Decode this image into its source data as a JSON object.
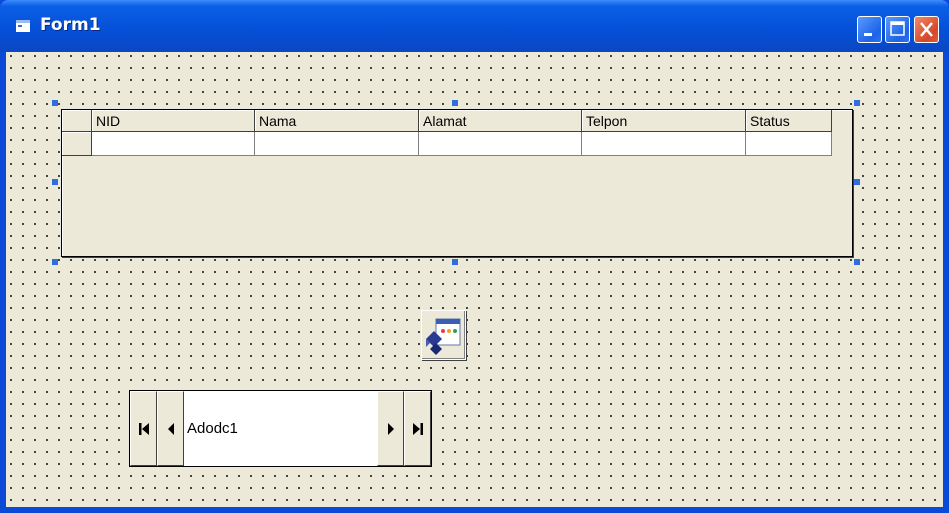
{
  "window": {
    "title": "Form1",
    "colors": {
      "titlebar": "#0551d8",
      "form_background": "#ece9d8",
      "close_button": "#d6462a"
    }
  },
  "title_buttons": [
    "minimize-icon",
    "maximize-icon",
    "close-icon"
  ],
  "datagrid": {
    "columns": [
      "NID",
      "Nama",
      "Alamat",
      "Telpon",
      "Status"
    ],
    "rows": [
      [
        "",
        "",
        "",
        "",
        ""
      ]
    ]
  },
  "adodc": {
    "caption": "Adodc1",
    "buttons": [
      "move-first-icon",
      "move-previous-icon",
      "move-next-icon",
      "move-last-icon"
    ]
  },
  "component_icon": "adodc-component-icon"
}
